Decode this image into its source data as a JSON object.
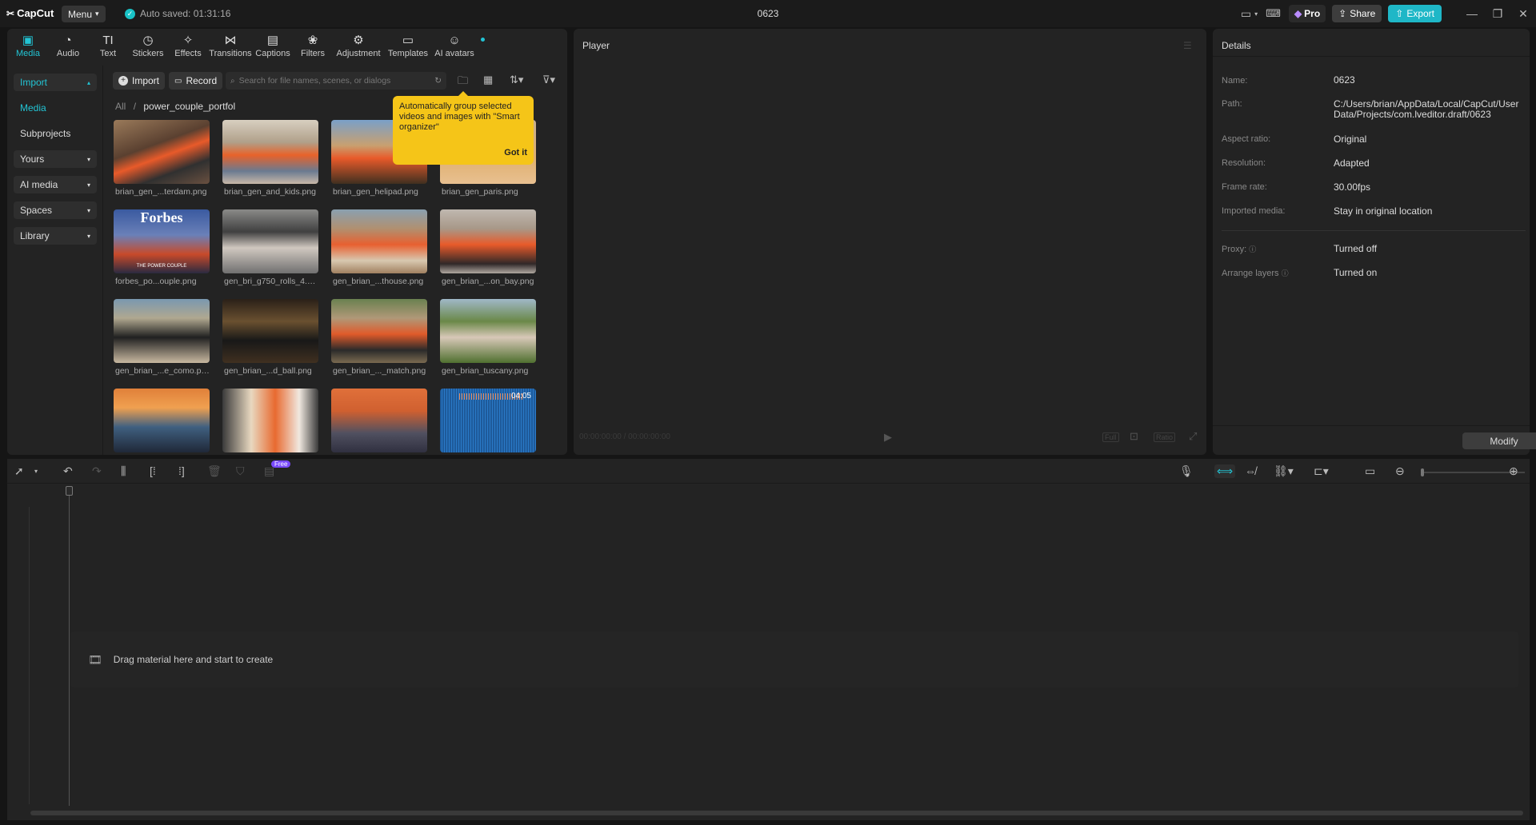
{
  "app": {
    "name": "CapCut",
    "menu_label": "Menu",
    "autosave": "Auto saved: 01:31:16",
    "project_title": "0623"
  },
  "header": {
    "pro_label": "Pro",
    "share_label": "Share",
    "export_label": "Export"
  },
  "tabs": [
    {
      "label": "Media",
      "icon": "media-icon"
    },
    {
      "label": "Audio",
      "icon": "audio-icon"
    },
    {
      "label": "Text",
      "icon": "text-icon"
    },
    {
      "label": "Stickers",
      "icon": "stickers-icon"
    },
    {
      "label": "Effects",
      "icon": "effects-icon"
    },
    {
      "label": "Transitions",
      "icon": "transitions-icon"
    },
    {
      "label": "Captions",
      "icon": "captions-icon"
    },
    {
      "label": "Filters",
      "icon": "filters-icon"
    },
    {
      "label": "Adjustment",
      "icon": "adjustment-icon"
    },
    {
      "label": "Templates",
      "icon": "templates-icon"
    },
    {
      "label": "AI avatars",
      "icon": "ai-avatars-icon"
    }
  ],
  "sidebar": {
    "import": "Import",
    "media": "Media",
    "subprojects": "Subprojects",
    "yours": "Yours",
    "ai_media": "AI media",
    "spaces": "Spaces",
    "library": "Library"
  },
  "media": {
    "import_label": "Import",
    "record_label": "Record",
    "search_placeholder": "Search for file names, scenes, or dialogs",
    "breadcrumb_root": "All",
    "breadcrumb_current": "power_couple_portfol",
    "items": [
      {
        "name": "brian_gen_...terdam.png"
      },
      {
        "name": "brian_gen_and_kids.png"
      },
      {
        "name": "brian_gen_helipad.png"
      },
      {
        "name": "brian_gen_paris.png"
      },
      {
        "name": "forbes_po...ouple.png"
      },
      {
        "name": "gen_bri_g750_rolls_4.png"
      },
      {
        "name": "gen_brian_...thouse.png"
      },
      {
        "name": "gen_brian_...on_bay.png"
      },
      {
        "name": "gen_brian_...e_como.png"
      },
      {
        "name": "gen_brian_...d_ball.png"
      },
      {
        "name": "gen_brian_..._match.png"
      },
      {
        "name": "gen_brian_tuscany.png"
      },
      {
        "name": ""
      },
      {
        "name": ""
      },
      {
        "name": ""
      },
      {
        "name": "",
        "duration": "04:05"
      }
    ],
    "forbes_text": "Forbes",
    "forbes_sub": "THE POWER COUPLE"
  },
  "tooltip": {
    "text": "Automatically group selected videos and images with \"Smart organizer\"",
    "button": "Got it"
  },
  "player": {
    "title": "Player",
    "timecode": "00:00:00:00 / 00:00:00:00",
    "full": "Full",
    "ratio": "Ratio"
  },
  "details": {
    "title": "Details",
    "rows": [
      {
        "label": "Name:",
        "value": "0623"
      },
      {
        "label": "Path:",
        "value": "C:/Users/brian/AppData/Local/CapCut/User Data/Projects/com.lveditor.draft/0623"
      },
      {
        "label": "Aspect ratio:",
        "value": "Original"
      },
      {
        "label": "Resolution:",
        "value": "Adapted"
      },
      {
        "label": "Frame rate:",
        "value": "30.00fps"
      },
      {
        "label": "Imported media:",
        "value": "Stay in original location"
      },
      {
        "label": "Proxy:",
        "value": "Turned off"
      },
      {
        "label": "Arrange layers",
        "value": "Turned on"
      }
    ],
    "modify_label": "Modify"
  },
  "timeline": {
    "free_badge": "Free",
    "drop_text": "Drag material here and start to create"
  }
}
